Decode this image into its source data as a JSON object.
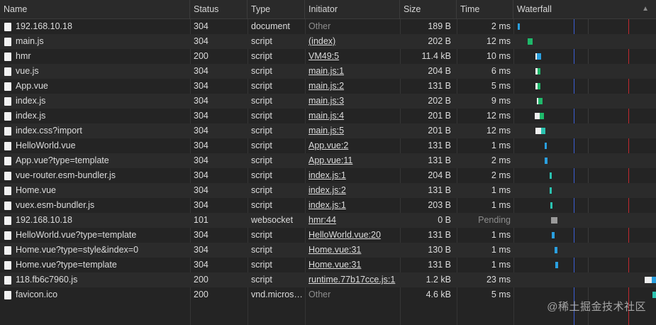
{
  "columns": {
    "name": "Name",
    "status": "Status",
    "type": "Type",
    "initiator": "Initiator",
    "size": "Size",
    "time": "Time",
    "waterfall": "Waterfall"
  },
  "sort_indicator": "▲",
  "rows": [
    {
      "name": "192.168.10.18",
      "status": "304",
      "type": "document",
      "initiator": "Other",
      "initiator_link": false,
      "size": "189 B",
      "time": "2 ms"
    },
    {
      "name": "main.js",
      "status": "304",
      "type": "script",
      "initiator": "(index)",
      "initiator_link": true,
      "size": "202 B",
      "time": "12 ms"
    },
    {
      "name": "hmr",
      "status": "200",
      "type": "script",
      "initiator": "VM49:5",
      "initiator_link": true,
      "size": "11.4 kB",
      "time": "10 ms"
    },
    {
      "name": "vue.js",
      "status": "304",
      "type": "script",
      "initiator": "main.js:1",
      "initiator_link": true,
      "size": "204 B",
      "time": "6 ms"
    },
    {
      "name": "App.vue",
      "status": "304",
      "type": "script",
      "initiator": "main.js:2",
      "initiator_link": true,
      "size": "131 B",
      "time": "5 ms"
    },
    {
      "name": "index.js",
      "status": "304",
      "type": "script",
      "initiator": "main.js:3",
      "initiator_link": true,
      "size": "202 B",
      "time": "9 ms"
    },
    {
      "name": "index.js",
      "status": "304",
      "type": "script",
      "initiator": "main.js:4",
      "initiator_link": true,
      "size": "201 B",
      "time": "12 ms"
    },
    {
      "name": "index.css?import",
      "status": "304",
      "type": "script",
      "initiator": "main.js:5",
      "initiator_link": true,
      "size": "201 B",
      "time": "12 ms"
    },
    {
      "name": "HelloWorld.vue",
      "status": "304",
      "type": "script",
      "initiator": "App.vue:2",
      "initiator_link": true,
      "size": "131 B",
      "time": "1 ms"
    },
    {
      "name": "App.vue?type=template",
      "status": "304",
      "type": "script",
      "initiator": "App.vue:11",
      "initiator_link": true,
      "size": "131 B",
      "time": "2 ms"
    },
    {
      "name": "vue-router.esm-bundler.js",
      "status": "304",
      "type": "script",
      "initiator": "index.js:1",
      "initiator_link": true,
      "size": "204 B",
      "time": "2 ms"
    },
    {
      "name": "Home.vue",
      "status": "304",
      "type": "script",
      "initiator": "index.js:2",
      "initiator_link": true,
      "size": "131 B",
      "time": "1 ms"
    },
    {
      "name": "vuex.esm-bundler.js",
      "status": "304",
      "type": "script",
      "initiator": "index.js:1",
      "initiator_link": true,
      "size": "203 B",
      "time": "1 ms"
    },
    {
      "name": "192.168.10.18",
      "status": "101",
      "type": "websocket",
      "initiator": "hmr:44",
      "initiator_link": true,
      "size": "0 B",
      "time": "Pending"
    },
    {
      "name": "HelloWorld.vue?type=template",
      "status": "304",
      "type": "script",
      "initiator": "HelloWorld.vue:20",
      "initiator_link": true,
      "size": "131 B",
      "time": "1 ms"
    },
    {
      "name": "Home.vue?type=style&index=0",
      "status": "304",
      "type": "script",
      "initiator": "Home.vue:31",
      "initiator_link": true,
      "size": "130 B",
      "time": "1 ms"
    },
    {
      "name": "Home.vue?type=template",
      "status": "304",
      "type": "script",
      "initiator": "Home.vue:31",
      "initiator_link": true,
      "size": "131 B",
      "time": "1 ms"
    },
    {
      "name": "118.fb6c7960.js",
      "status": "200",
      "type": "script",
      "initiator": "runtime.77b17cce.js:1",
      "initiator_link": true,
      "size": "1.2 kB",
      "time": "23 ms"
    },
    {
      "name": "favicon.ico",
      "status": "200",
      "type": "vnd.micros…",
      "initiator": "Other",
      "initiator_link": false,
      "size": "4.6 kB",
      "time": "5 ms"
    }
  ],
  "waterfall_colors": {
    "waiting": "#eeeeee",
    "download_green": "#1fb86a",
    "download_blue": "#2aa0e0",
    "download_teal": "#2bc2b0",
    "pending_gray": "#9a9a9a",
    "dom_content_loaded": "#3b5fd6",
    "load": "#c0282f"
  },
  "watermark": "@稀土掘金技术社区"
}
